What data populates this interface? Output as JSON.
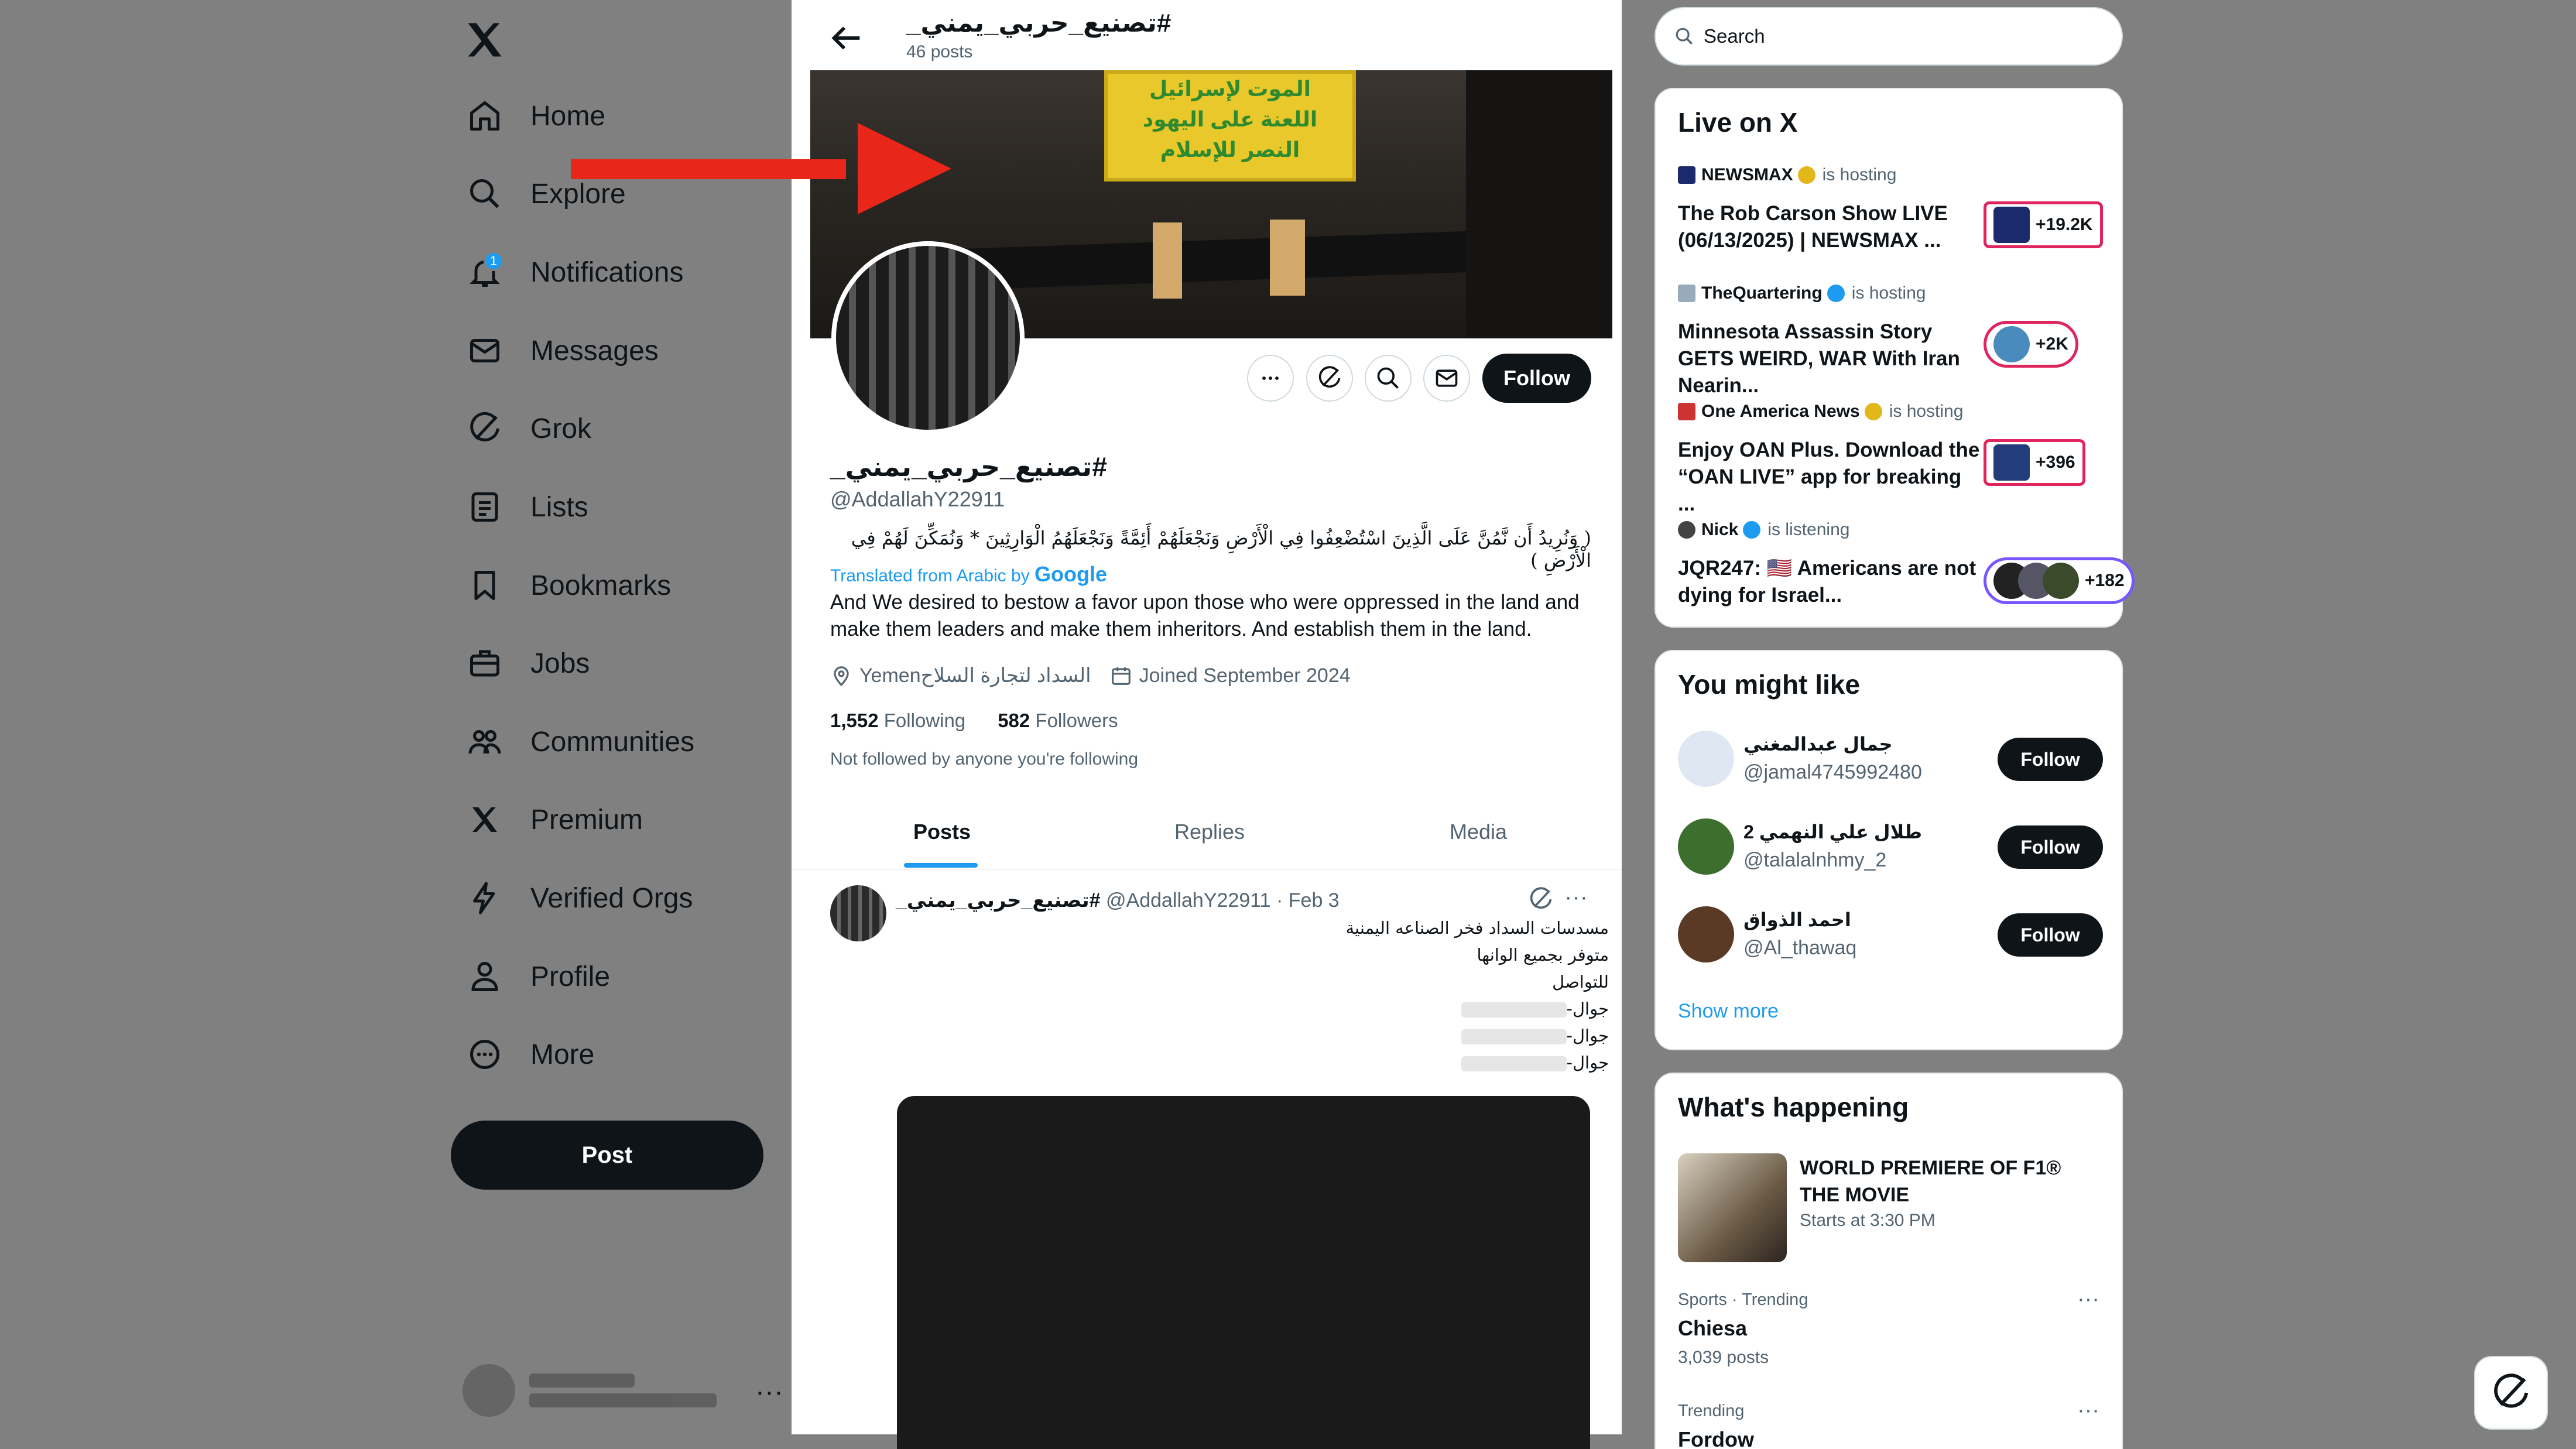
{
  "nav": {
    "items": [
      {
        "label": "Home",
        "icon": "home-icon"
      },
      {
        "label": "Explore",
        "icon": "search-icon"
      },
      {
        "label": "Notifications",
        "icon": "bell-icon",
        "badge": "1"
      },
      {
        "label": "Messages",
        "icon": "mail-icon"
      },
      {
        "label": "Grok",
        "icon": "grok-icon"
      },
      {
        "label": "Lists",
        "icon": "list-icon"
      },
      {
        "label": "Bookmarks",
        "icon": "bookmark-icon"
      },
      {
        "label": "Jobs",
        "icon": "briefcase-icon"
      },
      {
        "label": "Communities",
        "icon": "people-icon"
      },
      {
        "label": "Premium",
        "icon": "x-icon"
      },
      {
        "label": "Verified Orgs",
        "icon": "lightning-icon"
      },
      {
        "label": "Profile",
        "icon": "person-icon"
      },
      {
        "label": "More",
        "icon": "more-circle-icon"
      }
    ],
    "post_label": "Post"
  },
  "header": {
    "title": "#تصنيع_حربي_يمني_",
    "posts_count": "46 posts"
  },
  "banner": {
    "sign_lines": [
      "الموت لإسرائيل",
      "اللعنة على اليهود",
      "النصر للإسلام"
    ]
  },
  "profile": {
    "name": "#تصنيع_حربي_يمني_",
    "handle": "@AddallahY22911",
    "follow_label": "Follow",
    "bio_arabic": "( وَنُرِيدُ أَن نَّمُنَّ عَلَى الَّذِينَ اسْتُضْعِفُوا فِي الْأَرْضِ وَنَجْعَلَهُمْ أَئِمَّةً وَنَجْعَلَهُمُ الْوَارِثِينَ * وَنُمَكِّنَ لَهُمْ فِي الْأَرْضِ )",
    "translated_prefix": "Translated from Arabic by",
    "translated_brand": "Google",
    "bio_english": "And We desired to bestow a favor upon those who were oppressed in the land and make them leaders and make them inheritors. And establish them in the land.",
    "location": "السداد لتجارة السلاحYemen",
    "joined": "Joined September 2024",
    "following_count": "1,552",
    "following_label": "Following",
    "followers_count": "582",
    "followers_label": "Followers",
    "not_followed": "Not followed by anyone you're following"
  },
  "tabs": [
    {
      "label": "Posts",
      "active": true
    },
    {
      "label": "Replies",
      "active": false
    },
    {
      "label": "Media",
      "active": false
    }
  ],
  "tweet": {
    "name": "#تصنيع_حربي_يمني_",
    "handle_date": "@AddallahY22911 · Feb 3",
    "lines": [
      "مسدسات السداد فخر الصناعه اليمنية",
      "متوفر بجميع الوانها",
      "للتواصل",
      "جوال-",
      "جوال-",
      "جوال-"
    ]
  },
  "search": {
    "placeholder": "Search"
  },
  "live": {
    "title": "Live on X",
    "items": [
      {
        "host": "NEWSMAX",
        "status": "is hosting",
        "title": "The Rob Carson Show LIVE (06/13/2025) | NEWSMAX ...",
        "count": "+19.2K",
        "badge_color": "#e2b719"
      },
      {
        "host": "TheQuartering",
        "status": "is hosting",
        "title": "Minnesota Assassin Story GETS WEIRD, WAR With Iran Nearin...",
        "count": "+2K",
        "badge_color": "#1d9bf0"
      },
      {
        "host": "One America News",
        "status": "is hosting",
        "title": "Enjoy OAN Plus. Download the “OAN LIVE” app for breaking ...",
        "count": "+396",
        "badge_color": "#e2b719"
      },
      {
        "host": "Nick",
        "status": "is listening",
        "title": "JQR247: 🇺🇸 Americans are not dying for Israel...",
        "count": "+182",
        "badge_color": "#1d9bf0"
      }
    ]
  },
  "suggest": {
    "title": "You might like",
    "items": [
      {
        "name": "جمال عبدالمغني",
        "handle": "@jamal4745992480",
        "follow": "Follow"
      },
      {
        "name": "طلال علي النهمي 2",
        "handle": "@talalalnhmy_2",
        "follow": "Follow"
      },
      {
        "name": "احمد الذواق",
        "handle": "@Al_thawaq",
        "follow": "Follow"
      }
    ],
    "show_more": "Show more"
  },
  "happening": {
    "title": "What's happening",
    "event_title": "WORLD PREMIERE OF F1® THE MOVIE",
    "event_time": "Starts at 3:30 PM",
    "trends": [
      {
        "category": "Sports · Trending",
        "name": "Chiesa",
        "count": "3,039 posts"
      },
      {
        "category": "Trending",
        "name": "Fordow",
        "count": ""
      }
    ]
  },
  "colors": {
    "accent": "#1d9bf0",
    "annotation_arrow": "#e8261a",
    "live_ring": "#e0245e",
    "space_ring": "#7856ff"
  }
}
